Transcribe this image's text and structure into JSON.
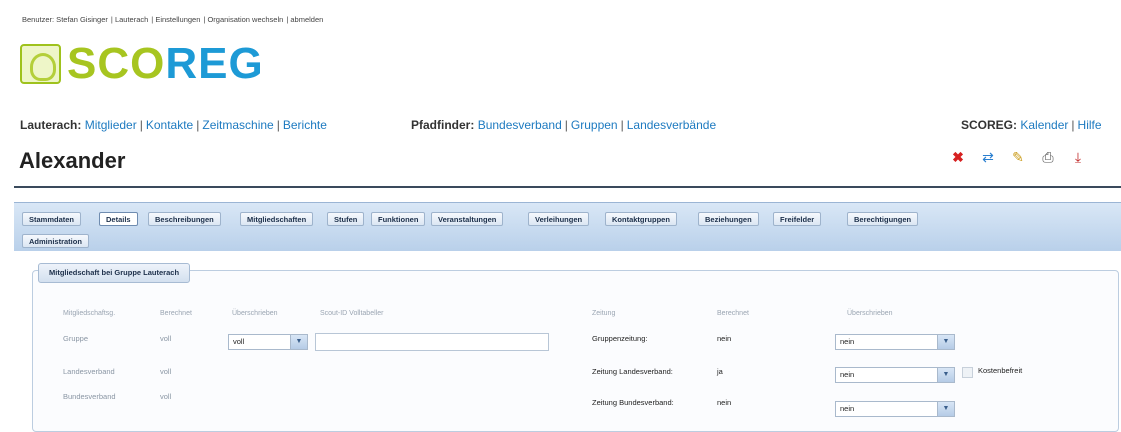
{
  "topbar": {
    "user_label": "Benutzer: Stefan Gisinger",
    "items": [
      "Lauterach",
      "Einstellungen",
      "Organisation wechseln",
      "abmelden"
    ]
  },
  "logo": {
    "part1": "SCO",
    "part2": "REG"
  },
  "nav": {
    "group1": {
      "title": "Lauterach:",
      "links": [
        "Mitglieder",
        "Kontakte",
        "Zeitmaschine",
        "Berichte"
      ]
    },
    "group2": {
      "title": "Pfadfinder:",
      "links": [
        "Bundesverband",
        "Gruppen",
        "Landesverbände"
      ]
    },
    "group3": {
      "title": "SCOREG:",
      "links": [
        "Kalender",
        "Hilfe"
      ]
    }
  },
  "page": {
    "title": "Alexander"
  },
  "actions": {
    "delete": "✖",
    "refresh": "⇄",
    "edit": "✎",
    "print": "⎙",
    "pdf": "⤓"
  },
  "tabs": [
    "Stammdaten",
    "Details",
    "Beschreibungen",
    "Mitgliedschaften",
    "Stufen",
    "Funktionen",
    "Veranstaltungen",
    "Verleihungen",
    "Kontaktgruppen",
    "Beziehungen",
    "Freifelder",
    "Berechtigungen",
    "Administration"
  ],
  "tab_active": "Details",
  "section": {
    "legend": "Mitgliedschaft bei Gruppe Lauterach",
    "left_headers": [
      "Mitgliedschaftsg.",
      "Berechnet",
      "Überschrieben",
      "Scout-ID Volltabeller"
    ],
    "left_rows": [
      {
        "label": "Gruppe",
        "value": "voll",
        "override": "voll"
      },
      {
        "label": "Landesverband",
        "value": "voll"
      },
      {
        "label": "Bundesverband",
        "value": "voll"
      }
    ],
    "right_headers": [
      "Zeitung",
      "Berechnet",
      "Überschrieben"
    ],
    "right_rows": [
      {
        "label": "Gruppenzeitung:",
        "value": "nein",
        "override": "nein"
      },
      {
        "label": "Zeitung Landesverband:",
        "value": "ja",
        "override": "nein"
      },
      {
        "label": "Zeitung Bundesverband:",
        "value": "nein",
        "override": "nein"
      }
    ],
    "kostenbefreit_label": "Kostenbefreit"
  },
  "colors": {
    "accent_green": "#a7c520",
    "accent_blue": "#1d9ad6",
    "link": "#1d7ac0",
    "delete": "#d62020"
  }
}
